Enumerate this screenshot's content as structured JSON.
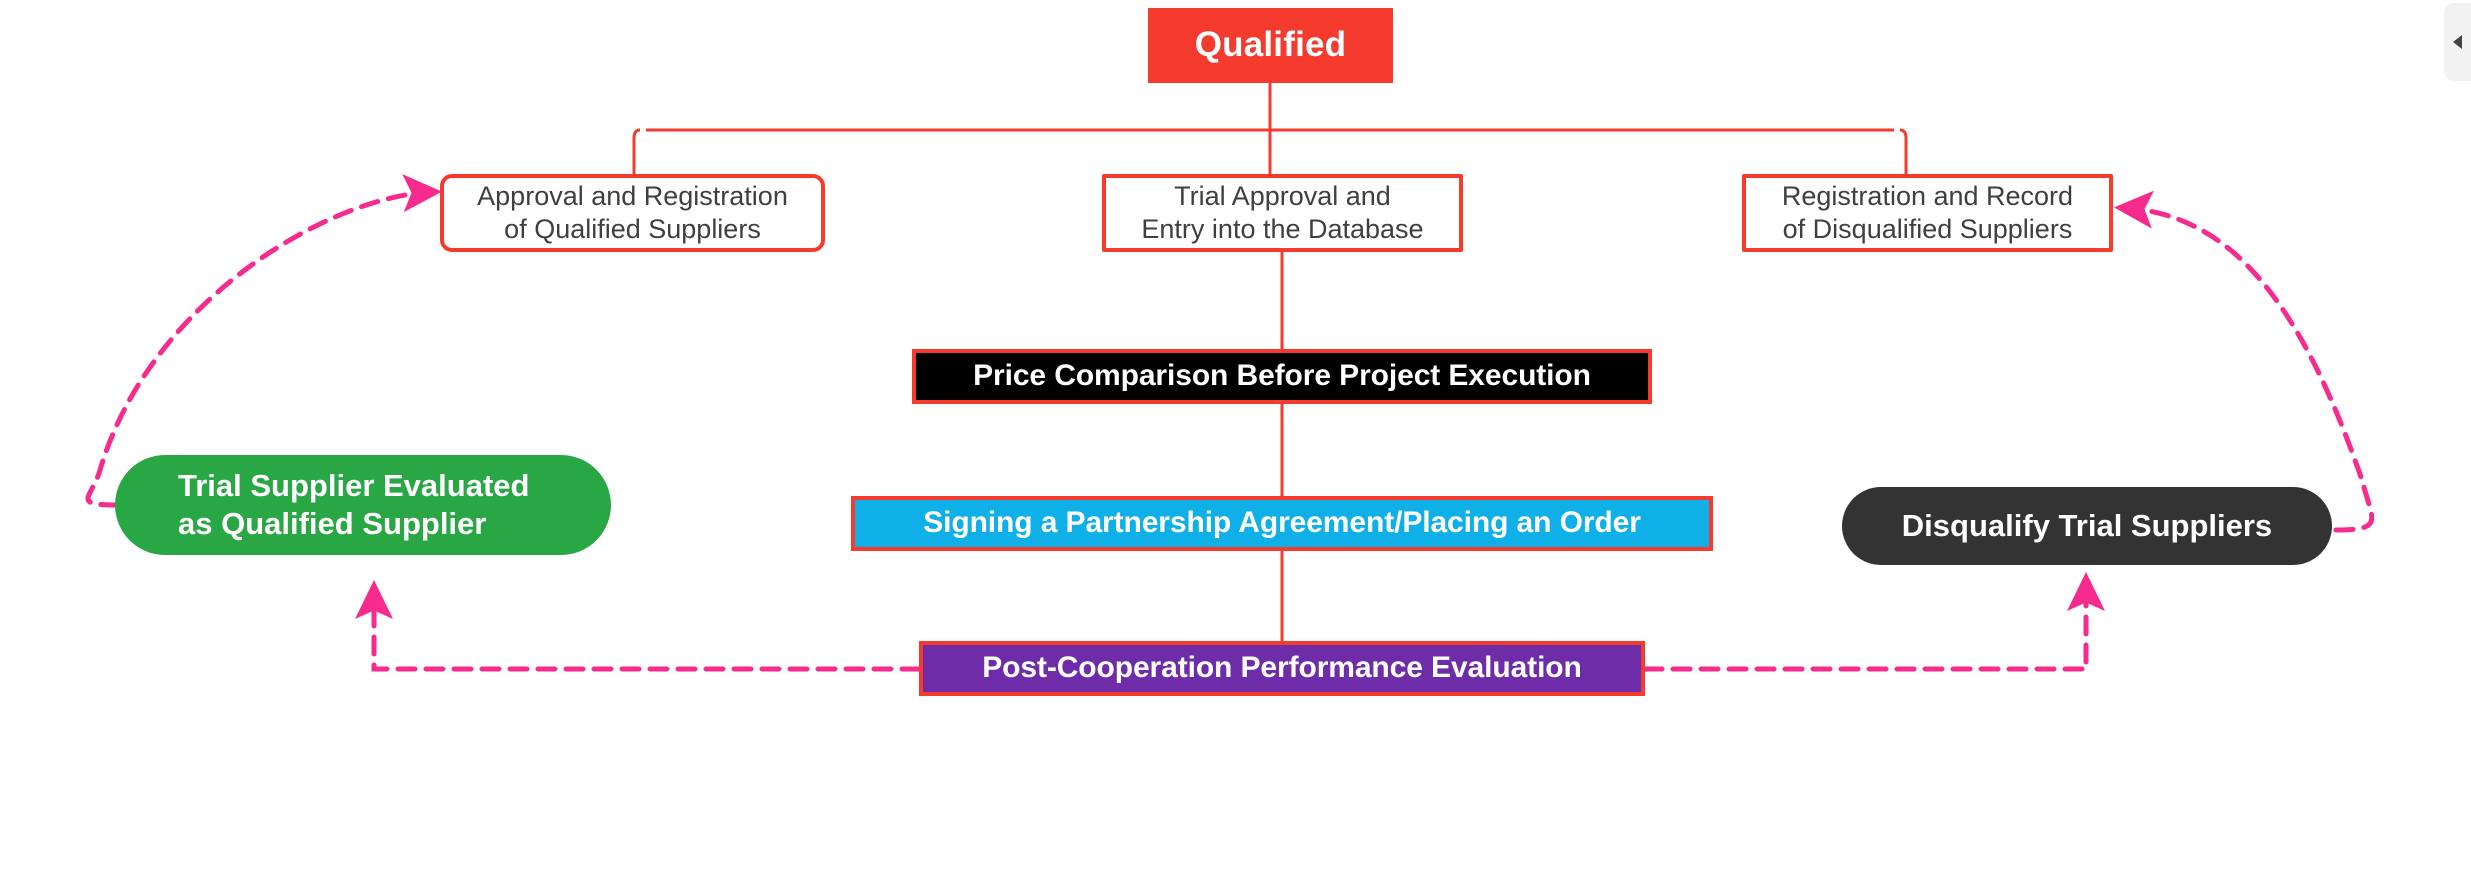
{
  "diagram": {
    "title": "Supplier Qualification Flow",
    "colors": {
      "red": "#F53B2E",
      "pink": "#F72A8E",
      "green": "#29A745",
      "dark": "#333333",
      "purple": "#6E2CA8",
      "blue": "#0FB0E8",
      "black": "#000000",
      "text_gray": "#3F3F3F",
      "white": "#FFFFFF"
    },
    "nodes": {
      "root": {
        "label": "Qualified",
        "shape": "rectangle",
        "fill": "#F53B2E",
        "text_color": "#FFFFFF"
      },
      "branch_left": {
        "label": "Approval and Registration\nof Qualified Suppliers",
        "shape": "rounded-rectangle",
        "fill": "#FFFFFF",
        "border": "#F53B2E",
        "text_color": "#3F3F3F"
      },
      "branch_center": {
        "label": "Trial Approval and\nEntry into the Database",
        "shape": "rectangle",
        "fill": "#FFFFFF",
        "border": "#F53B2E",
        "text_color": "#3F3F3F"
      },
      "branch_right": {
        "label": "Registration and Record\nof Disqualified Suppliers",
        "shape": "rectangle",
        "fill": "#FFFFFF",
        "border": "#F53B2E",
        "text_color": "#3F3F3F"
      },
      "price_comparison": {
        "label": "Price Comparison Before Project Execution",
        "shape": "rectangle",
        "fill": "#000000",
        "border": "#F53B2E",
        "text_color": "#FFFFFF"
      },
      "signing": {
        "label": "Signing a Partnership Agreement/Placing an Order",
        "shape": "rectangle",
        "fill": "#0FB0E8",
        "border": "#F53B2E",
        "text_color": "#FFFFFF"
      },
      "post_evaluation": {
        "label": "Post-Cooperation Performance Evaluation",
        "shape": "rectangle",
        "fill": "#6E2CA8",
        "border": "#F53B2E",
        "text_color": "#FFFFFF"
      },
      "trial_qualified": {
        "label": "Trial Supplier Evaluated\nas Qualified Supplier",
        "shape": "pill",
        "fill": "#29A745",
        "text_color": "#FFFFFF"
      },
      "disqualify": {
        "label": "Disqualify Trial Suppliers",
        "shape": "pill",
        "fill": "#333333",
        "text_color": "#FFFFFF"
      }
    },
    "edges": [
      {
        "from": "root",
        "to": "branch_left",
        "style": "solid",
        "color": "#F53B2E"
      },
      {
        "from": "root",
        "to": "branch_center",
        "style": "solid",
        "color": "#F53B2E"
      },
      {
        "from": "root",
        "to": "branch_right",
        "style": "solid",
        "color": "#F53B2E"
      },
      {
        "from": "branch_center",
        "to": "price_comparison",
        "style": "solid",
        "color": "#F53B2E"
      },
      {
        "from": "price_comparison",
        "to": "signing",
        "style": "solid",
        "color": "#F53B2E"
      },
      {
        "from": "signing",
        "to": "post_evaluation",
        "style": "solid",
        "color": "#F53B2E"
      },
      {
        "from": "post_evaluation",
        "to": "trial_qualified",
        "style": "dashed",
        "color": "#F72A8E",
        "arrow": true
      },
      {
        "from": "post_evaluation",
        "to": "disqualify",
        "style": "dashed",
        "color": "#F72A8E",
        "arrow": true
      },
      {
        "from": "trial_qualified",
        "to": "branch_left",
        "style": "dashed",
        "color": "#F72A8E",
        "arrow": true
      },
      {
        "from": "disqualify",
        "to": "branch_right",
        "style": "dashed",
        "color": "#F72A8E",
        "arrow": true
      }
    ]
  },
  "side_panel": {
    "collapse_icon": "chevron-right-icon"
  }
}
